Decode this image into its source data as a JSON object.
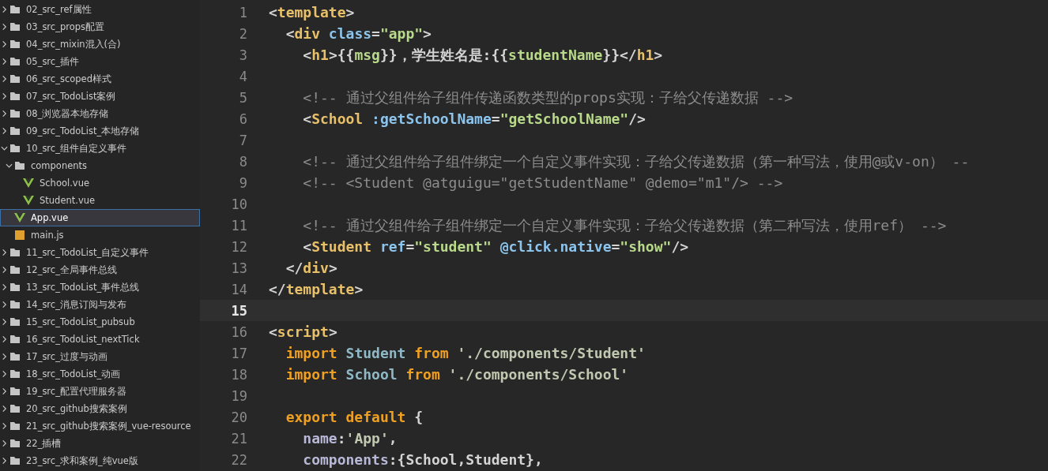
{
  "sidebar": {
    "items": [
      {
        "name": "02_src_ref属性",
        "kind": "folder",
        "expanded": false,
        "selected": false
      },
      {
        "name": "03_src_props配置",
        "kind": "folder",
        "expanded": false,
        "selected": false
      },
      {
        "name": "04_src_mixin混入(合)",
        "kind": "folder",
        "expanded": false,
        "selected": false
      },
      {
        "name": "05_src_插件",
        "kind": "folder",
        "expanded": false,
        "selected": false
      },
      {
        "name": "06_src_scoped样式",
        "kind": "folder",
        "expanded": false,
        "selected": false
      },
      {
        "name": "07_src_TodoList案例",
        "kind": "folder",
        "expanded": false,
        "selected": false
      },
      {
        "name": "08_浏览器本地存储",
        "kind": "folder",
        "expanded": false,
        "selected": false
      },
      {
        "name": "09_src_TodoList_本地存储",
        "kind": "folder",
        "expanded": false,
        "selected": false
      },
      {
        "name": "10_src_组件自定义事件",
        "kind": "folder",
        "expanded": true,
        "selected": false,
        "children": [
          {
            "name": "components",
            "kind": "folder",
            "expanded": true,
            "selected": false,
            "children": [
              {
                "name": "School.vue",
                "kind": "vue",
                "selected": false
              },
              {
                "name": "Student.vue",
                "kind": "vue",
                "selected": false
              }
            ]
          },
          {
            "name": "App.vue",
            "kind": "vue",
            "selected": true
          },
          {
            "name": "main.js",
            "kind": "js",
            "selected": false
          }
        ]
      },
      {
        "name": "11_src_TodoList_自定义事件",
        "kind": "folder",
        "expanded": false,
        "selected": false
      },
      {
        "name": "12_src_全局事件总线",
        "kind": "folder",
        "expanded": false,
        "selected": false
      },
      {
        "name": "13_src_TodoList_事件总线",
        "kind": "folder",
        "expanded": false,
        "selected": false
      },
      {
        "name": "14_src_消息订阅与发布",
        "kind": "folder",
        "expanded": false,
        "selected": false
      },
      {
        "name": "15_src_TodoList_pubsub",
        "kind": "folder",
        "expanded": false,
        "selected": false
      },
      {
        "name": "16_src_TodoList_nextTick",
        "kind": "folder",
        "expanded": false,
        "selected": false
      },
      {
        "name": "17_src_过度与动画",
        "kind": "folder",
        "expanded": false,
        "selected": false
      },
      {
        "name": "18_src_TodoList_动画",
        "kind": "folder",
        "expanded": false,
        "selected": false
      },
      {
        "name": "19_src_配置代理服务器",
        "kind": "folder",
        "expanded": false,
        "selected": false
      },
      {
        "name": "20_src_github搜索案例",
        "kind": "folder",
        "expanded": false,
        "selected": false
      },
      {
        "name": "21_src_github搜索案例_vue-resource",
        "kind": "folder",
        "expanded": false,
        "selected": false
      },
      {
        "name": "22_插槽",
        "kind": "folder",
        "expanded": false,
        "selected": false
      },
      {
        "name": "23_src_求和案例_纯vue版",
        "kind": "folder",
        "expanded": false,
        "selected": false
      }
    ]
  },
  "editor": {
    "lines": [
      {
        "number": "1",
        "current": false,
        "tokens": [
          {
            "text": "<",
            "kind": "punct"
          },
          {
            "text": "template",
            "kind": "tag"
          },
          {
            "text": ">",
            "kind": "punct"
          }
        ]
      },
      {
        "number": "2",
        "current": false,
        "tokens": [
          {
            "text": "  <",
            "kind": "punct"
          },
          {
            "text": "div",
            "kind": "tag"
          },
          {
            "text": " class",
            "kind": "attr"
          },
          {
            "text": "=",
            "kind": "punct"
          },
          {
            "text": "\"app\"",
            "kind": "string"
          },
          {
            "text": ">",
            "kind": "punct"
          }
        ]
      },
      {
        "number": "3",
        "current": false,
        "tokens": [
          {
            "text": "    <",
            "kind": "punct"
          },
          {
            "text": "h1",
            "kind": "tag"
          },
          {
            "text": ">{{",
            "kind": "punct"
          },
          {
            "text": "msg",
            "kind": "string"
          },
          {
            "text": "}}，学生姓名是:{{",
            "kind": "punct"
          },
          {
            "text": "studentName",
            "kind": "string"
          },
          {
            "text": "}}</",
            "kind": "punct"
          },
          {
            "text": "h1",
            "kind": "tag"
          },
          {
            "text": ">",
            "kind": "punct"
          }
        ]
      },
      {
        "number": "4",
        "current": false
      },
      {
        "number": "5",
        "current": false,
        "tokens": [
          {
            "text": "    <!-- 通过父组件给子组件传递函数类型的props实现：子给父传递数据 -->",
            "kind": "comment"
          }
        ]
      },
      {
        "number": "6",
        "current": false,
        "tokens": [
          {
            "text": "    <",
            "kind": "punct"
          },
          {
            "text": "School",
            "kind": "tag"
          },
          {
            "text": " :getSchoolName",
            "kind": "attr"
          },
          {
            "text": "=",
            "kind": "punct"
          },
          {
            "text": "\"getSchoolName\"",
            "kind": "string"
          },
          {
            "text": "/>",
            "kind": "punct"
          }
        ]
      },
      {
        "number": "7",
        "current": false
      },
      {
        "number": "8",
        "current": false,
        "tokens": [
          {
            "text": "    <!-- 通过父组件给子组件绑定一个自定义事件实现：子给父传递数据（第一种写法，使用@或v-on） --",
            "kind": "comment"
          }
        ]
      },
      {
        "number": "9",
        "current": false,
        "tokens": [
          {
            "text": "    <!-- <Student @atguigu=\"getStudentName\" @demo=\"m1\"/> -->",
            "kind": "comment"
          }
        ]
      },
      {
        "number": "10",
        "current": false
      },
      {
        "number": "11",
        "current": false,
        "tokens": [
          {
            "text": "    <!-- 通过父组件给子组件绑定一个自定义事件实现：子给父传递数据（第二种写法，使用ref） -->",
            "kind": "comment"
          }
        ]
      },
      {
        "number": "12",
        "current": false,
        "tokens": [
          {
            "text": "    <",
            "kind": "punct"
          },
          {
            "text": "Student",
            "kind": "tag"
          },
          {
            "text": " ref",
            "kind": "attr"
          },
          {
            "text": "=",
            "kind": "punct"
          },
          {
            "text": "\"student\"",
            "kind": "string"
          },
          {
            "text": " @click.native",
            "kind": "attr"
          },
          {
            "text": "=",
            "kind": "punct"
          },
          {
            "text": "\"show\"",
            "kind": "string"
          },
          {
            "text": "/>",
            "kind": "punct"
          }
        ]
      },
      {
        "number": "13",
        "current": false,
        "tokens": [
          {
            "text": "  </",
            "kind": "punct"
          },
          {
            "text": "div",
            "kind": "tag"
          },
          {
            "text": ">",
            "kind": "punct"
          }
        ]
      },
      {
        "number": "14",
        "current": false,
        "tokens": [
          {
            "text": "</",
            "kind": "punct"
          },
          {
            "text": "template",
            "kind": "tag"
          },
          {
            "text": ">",
            "kind": "punct"
          }
        ]
      },
      {
        "number": "15",
        "current": true
      },
      {
        "number": "16",
        "current": false,
        "tokens": [
          {
            "text": "<",
            "kind": "punct"
          },
          {
            "text": "script",
            "kind": "tag"
          },
          {
            "text": ">",
            "kind": "punct"
          }
        ]
      },
      {
        "number": "17",
        "current": false,
        "tokens": [
          {
            "text": "  import",
            "kind": "keyword"
          },
          {
            "text": " Student ",
            "kind": "identifier"
          },
          {
            "text": "from",
            "kind": "keyword"
          },
          {
            "text": " './components/Student'",
            "kind": "literal"
          }
        ]
      },
      {
        "number": "18",
        "current": false,
        "tokens": [
          {
            "text": "  import",
            "kind": "keyword"
          },
          {
            "text": " School ",
            "kind": "identifier"
          },
          {
            "text": "from",
            "kind": "keyword"
          },
          {
            "text": " './components/School'",
            "kind": "literal"
          }
        ]
      },
      {
        "number": "19",
        "current": false
      },
      {
        "number": "20",
        "current": false,
        "tokens": [
          {
            "text": "  export default",
            "kind": "keyword"
          },
          {
            "text": " {",
            "kind": "punct"
          }
        ]
      },
      {
        "number": "21",
        "current": false,
        "tokens": [
          {
            "text": "    name",
            "kind": "property"
          },
          {
            "text": ":",
            "kind": "punct"
          },
          {
            "text": "'App'",
            "kind": "literal"
          },
          {
            "text": ",",
            "kind": "punct"
          }
        ]
      },
      {
        "number": "22",
        "current": false,
        "tokens": [
          {
            "text": "    components",
            "kind": "property"
          },
          {
            "text": ":{School,Student},",
            "kind": "punct"
          }
        ]
      }
    ]
  }
}
